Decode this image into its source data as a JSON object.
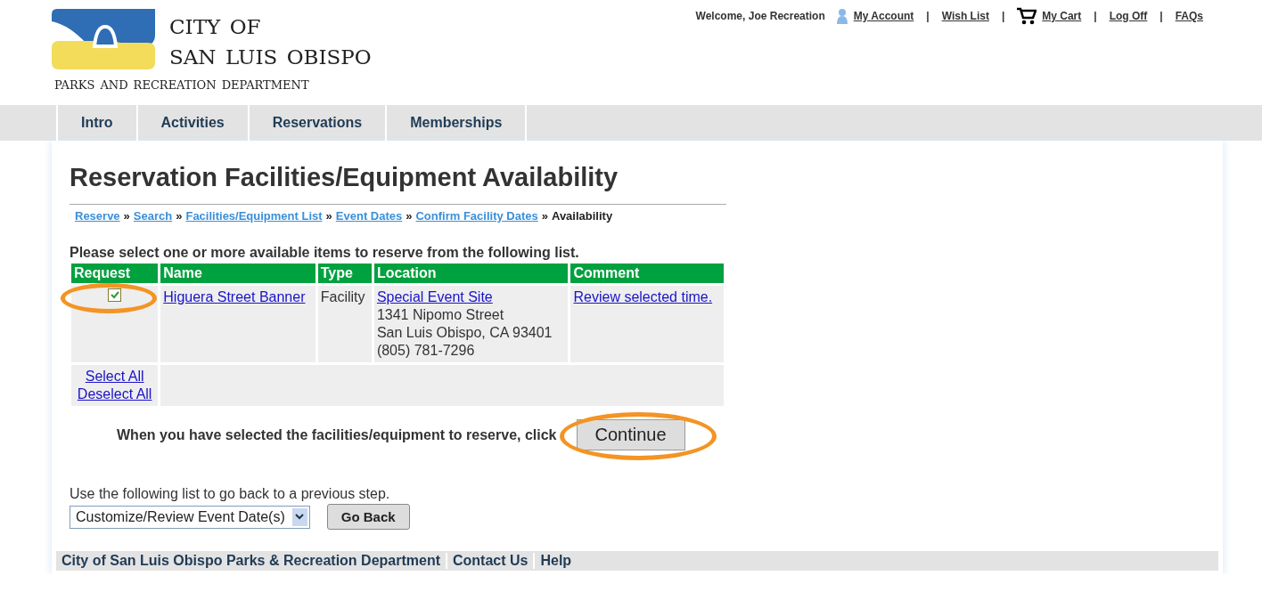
{
  "logo": {
    "line_1": "city of",
    "line_2": "san luis obispo",
    "subtitle": "parks and recreation department"
  },
  "account_bar": {
    "welcome": "Welcome, Joe Recreation",
    "links": [
      {
        "label": "My Account",
        "kind": "account"
      },
      {
        "label": "Wish List",
        "kind": "plain"
      },
      {
        "label": "My Cart",
        "kind": "cart"
      },
      {
        "label": "Log Off",
        "kind": "plain"
      },
      {
        "label": "FAQs",
        "kind": "plain"
      }
    ],
    "separator": "|"
  },
  "nav": [
    {
      "label": "Intro"
    },
    {
      "label": "Activities"
    },
    {
      "label": "Reservations"
    },
    {
      "label": "Memberships"
    }
  ],
  "title": "Reservation Facilities/Equipment Availability",
  "breadcrumb": {
    "links": [
      "Reserve",
      "Search",
      "Facilities/Equipment List",
      "Event Dates",
      "Confirm Facility Dates"
    ],
    "current": "Availability",
    "separator": "»"
  },
  "instruction": "Please select one or more available items to reserve from the following list.",
  "table": {
    "columns": [
      "Request",
      "Name",
      "Type",
      "Location",
      "Comment"
    ],
    "rows": [
      {
        "checked": true,
        "circled": true,
        "name": "Higuera Street Banner",
        "type": "Facility",
        "location_link": "Special Event Site",
        "address": [
          "1341 Nipomo Street",
          "San Luis Obispo, CA 93401",
          "(805) 781-7296"
        ],
        "comment": "Review selected time."
      }
    ],
    "select_all": "Select All",
    "deselect_all": "Deselect All"
  },
  "continue": {
    "prompt": "When you have selected the facilities/equipment to reserve, click",
    "button": "Continue",
    "circled": true
  },
  "go_back": {
    "prompt": "Use the following list to go back to a previous step.",
    "select_value": "Customize/Review Event Date(s)",
    "button": "Go Back"
  },
  "footer": [
    "City of San Luis Obispo Parks & Recreation Department",
    "Contact Us",
    "Help"
  ]
}
